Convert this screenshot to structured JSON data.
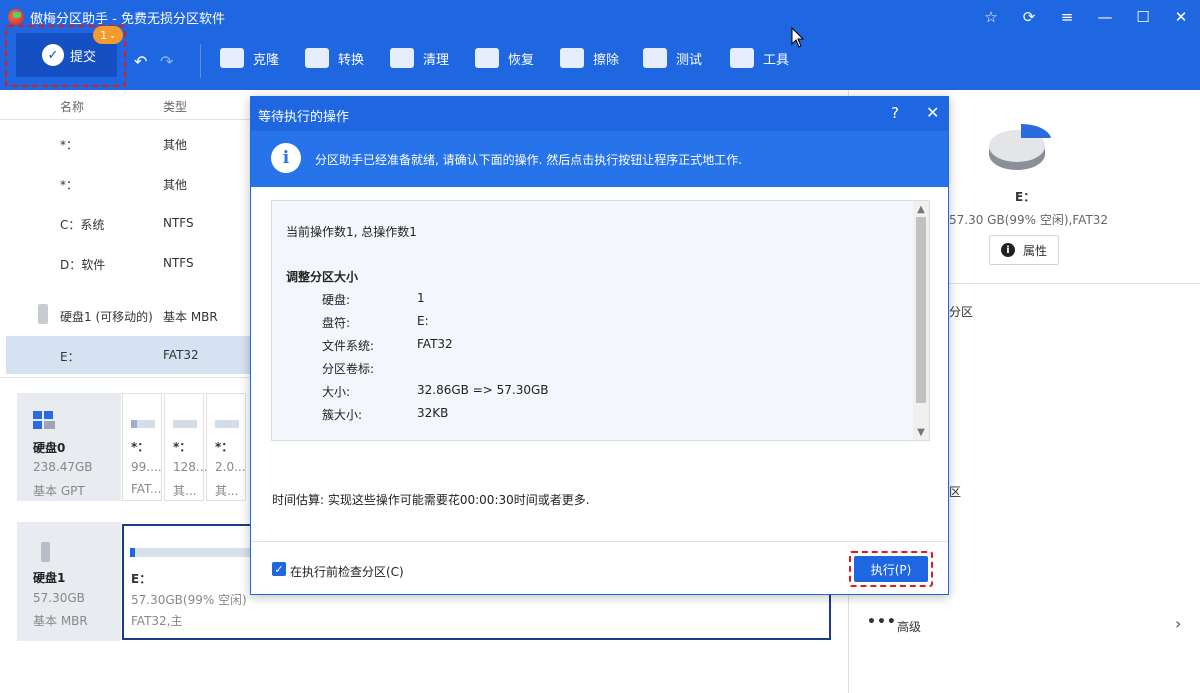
{
  "titlebar": {
    "title": "傲梅分区助手 - 免费无损分区软件"
  },
  "toolbar": {
    "submit_label": "提交",
    "badge": "1",
    "tools": [
      {
        "label": "克隆",
        "icon": "clone-icon"
      },
      {
        "label": "转换",
        "icon": "convert-icon"
      },
      {
        "label": "清理",
        "icon": "clean-icon"
      },
      {
        "label": "恢复",
        "icon": "recover-icon"
      },
      {
        "label": "擦除",
        "icon": "wipe-icon"
      },
      {
        "label": "测试",
        "icon": "test-icon"
      },
      {
        "label": "工具",
        "icon": "tools-icon"
      }
    ]
  },
  "tree": {
    "col_name": "名称",
    "col_type": "类型",
    "rows": [
      {
        "name": "*：",
        "type": "其他"
      },
      {
        "name": "*：",
        "type": "其他"
      },
      {
        "name": "C：系统",
        "type": "NTFS"
      },
      {
        "name": "D：软件",
        "type": "NTFS"
      },
      {
        "name": "硬盘1 (可移动的)",
        "type": "基本 MBR"
      },
      {
        "name": "E：",
        "type": "FAT32"
      }
    ]
  },
  "diskmap": {
    "disk0": {
      "name": "硬盘0",
      "size": "238.47GB",
      "style": "基本 GPT"
    },
    "disk0_parts": [
      {
        "label": "*：",
        "size": "99....",
        "fs": "FAT..."
      },
      {
        "label": "*：",
        "size": "128...",
        "fs": "其..."
      },
      {
        "label": "*：",
        "size": "2.0...",
        "fs": "其..."
      }
    ],
    "disk1": {
      "name": "硬盘1",
      "size": "57.30GB",
      "style": "基本 MBR"
    },
    "e_part": {
      "label": "E：",
      "size": "57.30GB(99% 空闲)",
      "fs": "FAT32,主"
    }
  },
  "right_panel": {
    "drive_label": "E：",
    "drive_info": "57.30 GB(99% 空闲),FAT32",
    "properties_label": "属性",
    "section1": "分区",
    "section2": "区",
    "advanced_label": "高级"
  },
  "dialog": {
    "title": "等待执行的操作",
    "info": "分区助手已经准备就绪, 请确认下面的操作. 然后点击执行按钮让程序正式地工作.",
    "op_count": "当前操作数1, 总操作数1",
    "op_title": "调整分区大小",
    "details": [
      {
        "key": "硬盘:",
        "value": "1"
      },
      {
        "key": "盘符:",
        "value": "E:"
      },
      {
        "key": "文件系统:",
        "value": "FAT32"
      },
      {
        "key": "分区卷标:",
        "value": ""
      },
      {
        "key": "大小:",
        "value": "32.86GB => 57.30GB"
      },
      {
        "key": "簇大小:",
        "value": "32KB"
      }
    ],
    "time_estimate": "时间估算: 实现这些操作可能需要花00:00:30时间或者更多.",
    "checkbox_label": "在执行前检查分区(C)",
    "execute_label": "执行(P)"
  }
}
